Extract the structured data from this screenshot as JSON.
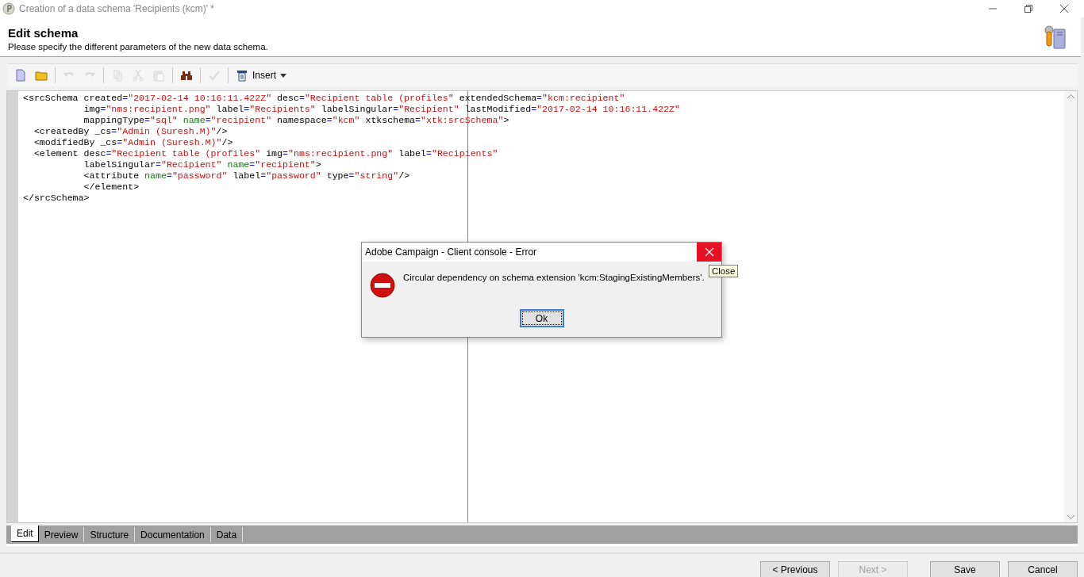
{
  "window": {
    "title": "Creation of a data schema 'Recipients (kcm)' *"
  },
  "header": {
    "title": "Edit schema",
    "subtitle": "Please specify the different parameters of the new data schema."
  },
  "toolbar": {
    "items": [
      {
        "kind": "new",
        "disabled": false
      },
      {
        "kind": "open",
        "disabled": false
      },
      {
        "kind": "undo",
        "disabled": true
      },
      {
        "kind": "redo",
        "disabled": true
      },
      {
        "kind": "copy",
        "disabled": true
      },
      {
        "kind": "cut",
        "disabled": true
      },
      {
        "kind": "paste",
        "disabled": true
      },
      {
        "kind": "find",
        "disabled": false
      },
      {
        "kind": "check",
        "disabled": true
      }
    ],
    "insert": {
      "label": "Insert"
    }
  },
  "editor": {
    "lines": [
      {
        "segments": [
          {
            "kind": "text",
            "text": "<srcSchema created"
          },
          {
            "kind": "eq",
            "text": "="
          },
          {
            "kind": "str",
            "text": "\"2017-02-14 10:16:11.422Z\""
          },
          {
            "kind": "text",
            "text": " desc"
          },
          {
            "kind": "eq",
            "text": "="
          },
          {
            "kind": "str",
            "text": "\"Recipient table (profiles\""
          },
          {
            "kind": "text",
            "text": " extendedSchema"
          },
          {
            "kind": "eq",
            "text": "="
          },
          {
            "kind": "str",
            "text": "\"kcm:recipient\""
          }
        ]
      },
      {
        "segments": [
          {
            "kind": "text",
            "text": "           img"
          },
          {
            "kind": "eq",
            "text": "="
          },
          {
            "kind": "str",
            "text": "\"nms:recipient.png\""
          },
          {
            "kind": "text",
            "text": " label"
          },
          {
            "kind": "eq",
            "text": "="
          },
          {
            "kind": "str",
            "text": "\"Recipients\""
          },
          {
            "kind": "text",
            "text": " labelSingular"
          },
          {
            "kind": "eq",
            "text": "="
          },
          {
            "kind": "str",
            "text": "\"Recipient\""
          },
          {
            "kind": "text",
            "text": " lastModified"
          },
          {
            "kind": "eq",
            "text": "="
          },
          {
            "kind": "str",
            "text": "\"2017-02-14 10:16:11.422Z\""
          }
        ]
      },
      {
        "segments": [
          {
            "kind": "text",
            "text": "           mappingType"
          },
          {
            "kind": "eq",
            "text": "="
          },
          {
            "kind": "str",
            "text": "\"sql\""
          },
          {
            "kind": "key",
            "text": " name"
          },
          {
            "kind": "eq",
            "text": "="
          },
          {
            "kind": "str",
            "text": "\"recipient\""
          },
          {
            "kind": "text",
            "text": " namespace"
          },
          {
            "kind": "eq",
            "text": "="
          },
          {
            "kind": "str",
            "text": "\"kcm\""
          },
          {
            "kind": "text",
            "text": " xtkschema"
          },
          {
            "kind": "eq",
            "text": "="
          },
          {
            "kind": "str",
            "text": "\"xtk:srcSchema\""
          },
          {
            "kind": "text",
            "text": ">"
          }
        ]
      },
      {
        "segments": [
          {
            "kind": "text",
            "text": "  <createdBy _cs"
          },
          {
            "kind": "eq",
            "text": "="
          },
          {
            "kind": "str",
            "text": "\"Admin (Suresh.M)\""
          },
          {
            "kind": "text",
            "text": "/>"
          }
        ]
      },
      {
        "segments": [
          {
            "kind": "text",
            "text": "  <modifiedBy _cs"
          },
          {
            "kind": "eq",
            "text": "="
          },
          {
            "kind": "str",
            "text": "\"Admin (Suresh.M)\""
          },
          {
            "kind": "text",
            "text": "/>"
          }
        ]
      },
      {
        "segments": [
          {
            "kind": "text",
            "text": "  <element desc"
          },
          {
            "kind": "eq",
            "text": "="
          },
          {
            "kind": "str",
            "text": "\"Recipient table (profiles\""
          },
          {
            "kind": "text",
            "text": " img"
          },
          {
            "kind": "eq",
            "text": "="
          },
          {
            "kind": "str",
            "text": "\"nms:recipient.png\""
          },
          {
            "kind": "text",
            "text": " label"
          },
          {
            "kind": "eq",
            "text": "="
          },
          {
            "kind": "str",
            "text": "\"Recipients\""
          }
        ]
      },
      {
        "segments": [
          {
            "kind": "text",
            "text": "           labelSingular"
          },
          {
            "kind": "eq",
            "text": "="
          },
          {
            "kind": "str",
            "text": "\"Recipient\""
          },
          {
            "kind": "key",
            "text": " name"
          },
          {
            "kind": "eq",
            "text": "="
          },
          {
            "kind": "str",
            "text": "\"recipient\""
          },
          {
            "kind": "text",
            "text": ">"
          }
        ]
      },
      {
        "segments": [
          {
            "kind": "text",
            "text": "           <attribute "
          },
          {
            "kind": "key",
            "text": "name"
          },
          {
            "kind": "eq",
            "text": "="
          },
          {
            "kind": "str",
            "text": "\"password\""
          },
          {
            "kind": "text",
            "text": " label"
          },
          {
            "kind": "eq",
            "text": "="
          },
          {
            "kind": "str",
            "text": "\"password\""
          },
          {
            "kind": "text",
            "text": " type"
          },
          {
            "kind": "eq",
            "text": "="
          },
          {
            "kind": "str",
            "text": "\"string\""
          },
          {
            "kind": "text",
            "text": "/>"
          }
        ]
      },
      {
        "segments": [
          {
            "kind": "text",
            "text": "           </element>"
          }
        ]
      },
      {
        "segments": [
          {
            "kind": "text",
            "text": "</srcSchema>"
          }
        ]
      }
    ]
  },
  "tabs": [
    {
      "label": "Edit",
      "selected": true
    },
    {
      "label": "Preview",
      "selected": false
    },
    {
      "label": "Structure",
      "selected": false
    },
    {
      "label": "Documentation",
      "selected": false
    },
    {
      "label": "Data",
      "selected": false
    }
  ],
  "buttons": [
    {
      "label": "< Previous",
      "disabled": false,
      "kind": "nav"
    },
    {
      "label": "Next >",
      "disabled": true,
      "kind": "nav"
    },
    {
      "label": "Save",
      "disabled": false,
      "kind": "action"
    },
    {
      "label": "Cancel",
      "disabled": false,
      "kind": "action"
    }
  ],
  "dialog": {
    "title": "Adobe Campaign - Client console - Error",
    "message": "Circular dependency on schema extension 'kcm:StagingExistingMembers'.",
    "ok": "Ok",
    "close_tooltip": "Close",
    "close_hovered": true
  }
}
